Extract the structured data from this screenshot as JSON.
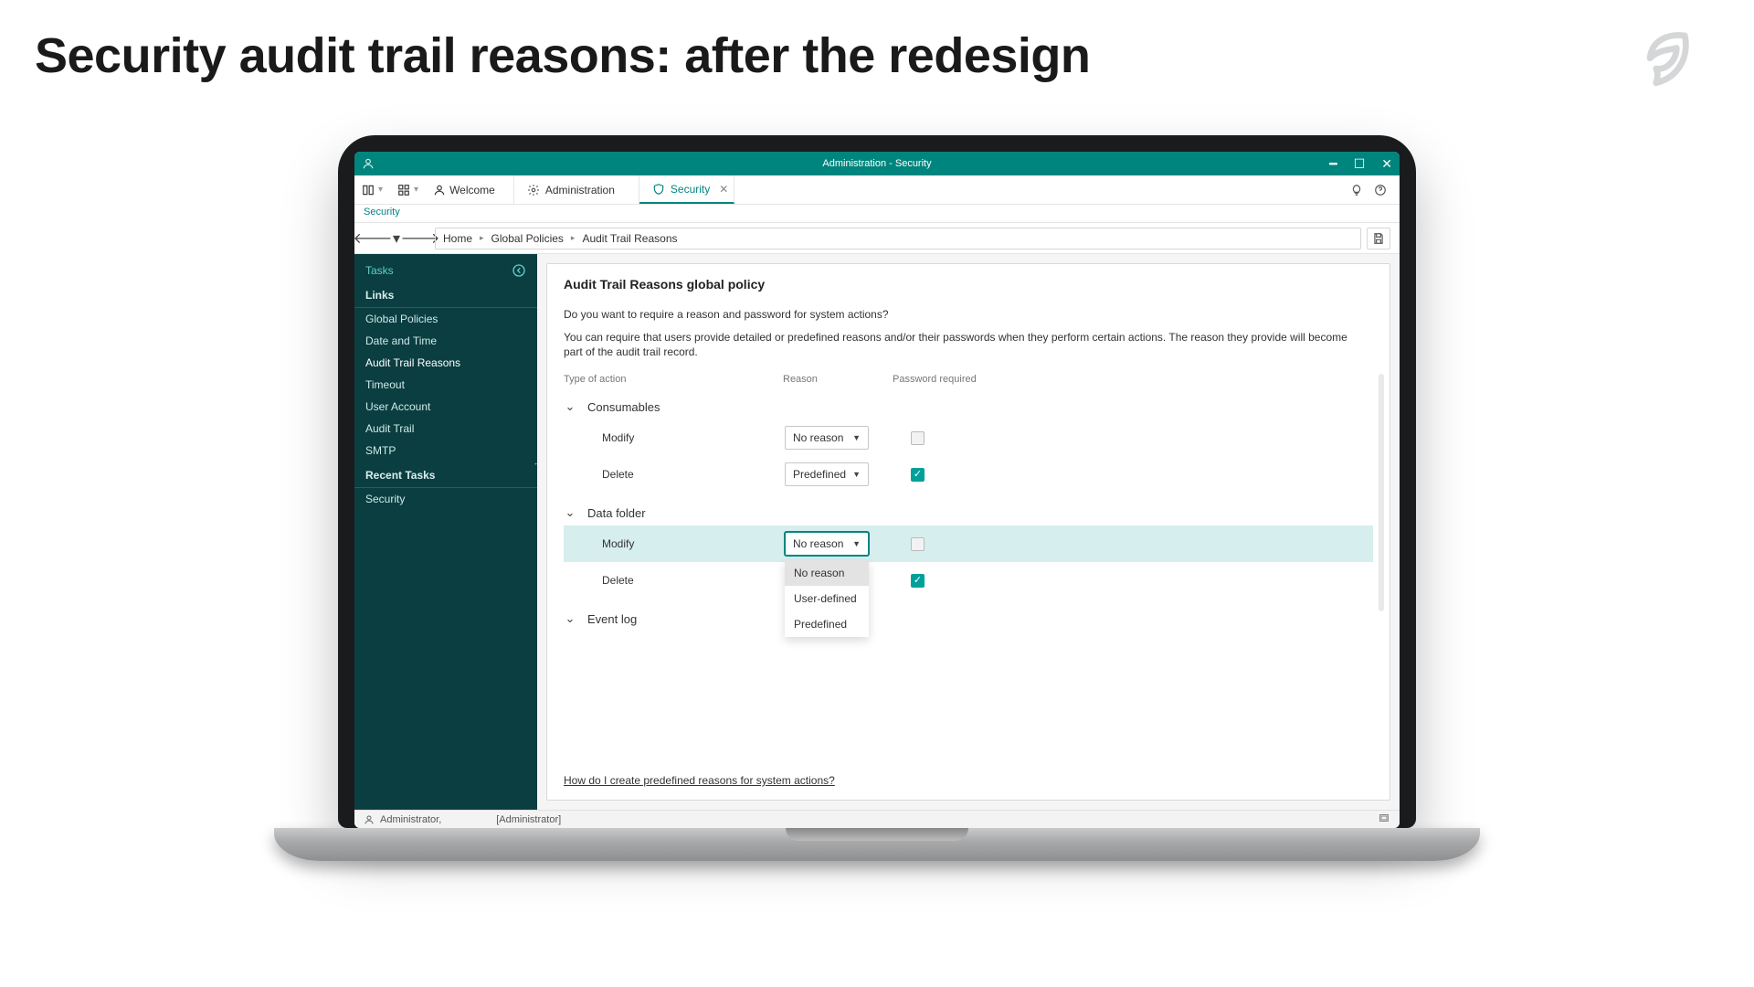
{
  "slide_title": "Security audit trail reasons: after the redesign",
  "window_title": "Administration - Security",
  "toolbar": {
    "welcome": "Welcome",
    "tabs": [
      {
        "icon": "gear-icon",
        "label": "Administration",
        "active": false,
        "closable": false
      },
      {
        "icon": "shield-icon",
        "label": "Security",
        "active": true,
        "closable": true
      }
    ]
  },
  "context_tab": "Security",
  "breadcrumb": [
    "Home",
    "Global Policies",
    "Audit Trail Reasons"
  ],
  "sidebar": {
    "tasks_label": "Tasks",
    "links_header": "Links",
    "links": [
      "Global Policies",
      "Date and Time",
      "Audit Trail Reasons",
      "Timeout",
      "User Account",
      "Audit Trail",
      "SMTP"
    ],
    "active_link_index": 2,
    "recent_header": "Recent Tasks",
    "recent": [
      "Security"
    ]
  },
  "panel": {
    "title": "Audit Trail Reasons global policy",
    "question": "Do you want to require a reason and password for system actions?",
    "description": "You can require that users provide detailed or predefined reasons and/or their passwords when they perform certain actions. The reason they provide will become part of the audit trail record.",
    "columns": {
      "action": "Type of action",
      "reason": "Reason",
      "password": "Password required"
    },
    "reason_options": [
      "No reason",
      "User-defined",
      "Predefined"
    ],
    "groups": [
      {
        "name": "Consumables",
        "rows": [
          {
            "action": "Modify",
            "reason": "No reason",
            "password": false,
            "focus": false,
            "highlight": false
          },
          {
            "action": "Delete",
            "reason": "Predefined",
            "password": true,
            "focus": false,
            "highlight": false
          }
        ]
      },
      {
        "name": "Data folder",
        "rows": [
          {
            "action": "Modify",
            "reason": "No reason",
            "password": false,
            "focus": true,
            "highlight": true,
            "open": true
          },
          {
            "action": "Delete",
            "reason": "",
            "password": true,
            "focus": false,
            "highlight": false
          }
        ]
      },
      {
        "name": "Event log",
        "rows": []
      }
    ],
    "help_link": "How do I create predefined reasons for system actions?"
  },
  "status": {
    "user": "Administrator,",
    "role": "[Administrator]"
  }
}
